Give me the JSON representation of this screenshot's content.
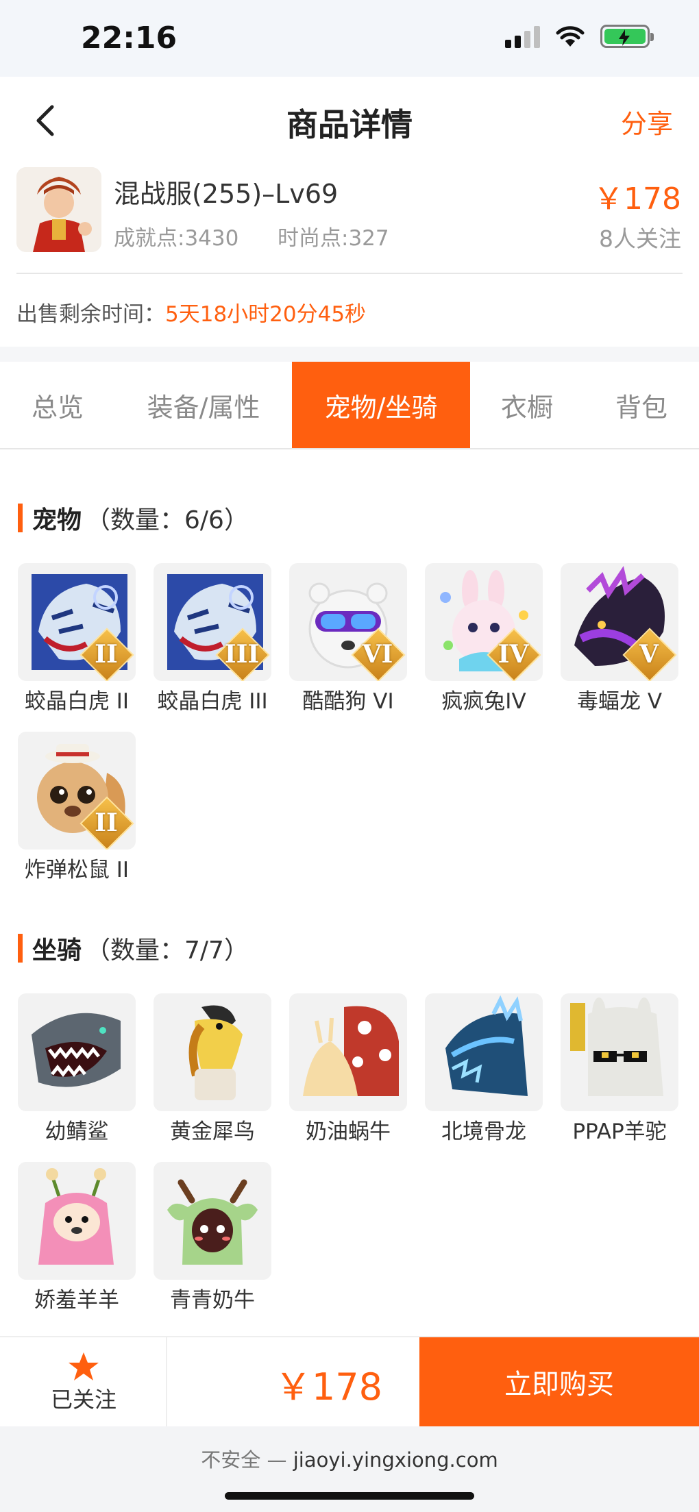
{
  "status_bar": {
    "time": "22:16"
  },
  "nav": {
    "title": "商品详情",
    "share_label": "分享"
  },
  "product": {
    "title": "混战服(255)–Lv69",
    "achievement_points": "成就点:3430",
    "fashion_points": "时尚点:327",
    "price": "￥178",
    "followers": "8人关注",
    "remaining_label": "出售剩余时间：",
    "remaining_time": "5天18小时20分45秒"
  },
  "tabs": [
    {
      "label": "总览"
    },
    {
      "label": "装备/属性"
    },
    {
      "label": "宠物/坐骑"
    },
    {
      "label": "衣橱"
    },
    {
      "label": "背包"
    }
  ],
  "pets": {
    "title": "宠物",
    "count": "（数量：6/6）",
    "items": [
      {
        "name": "蛟晶白虎 II",
        "badge": "II"
      },
      {
        "name": "蛟晶白虎 III",
        "badge": "III"
      },
      {
        "name": "酷酷狗 VI",
        "badge": "VI"
      },
      {
        "name": "疯疯兔IV",
        "badge": "IV"
      },
      {
        "name": "毒蝠龙 V",
        "badge": "V"
      },
      {
        "name": "炸弹松鼠 II",
        "badge": "II"
      }
    ]
  },
  "mounts": {
    "title": "坐骑",
    "count": "（数量：7/7）",
    "items": [
      {
        "name": "幼鲭鲨"
      },
      {
        "name": "黄金犀鸟"
      },
      {
        "name": "奶油蜗牛"
      },
      {
        "name": "北境骨龙"
      },
      {
        "name": "PPAP羊驼"
      },
      {
        "name": "娇羞羊羊"
      },
      {
        "name": "青青奶牛"
      }
    ]
  },
  "bottom": {
    "follow_label": "已关注",
    "price": "￥178",
    "buy_label": "立即购买"
  },
  "url_bar": {
    "insecure": "不安全 — ",
    "domain": "jiaoyi.yingxiong.com"
  },
  "colors": {
    "accent": "#ff5f0f"
  }
}
